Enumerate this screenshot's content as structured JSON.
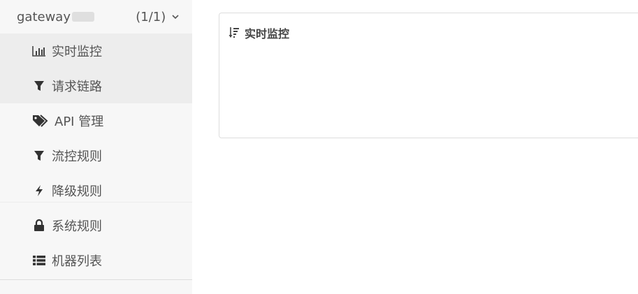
{
  "sidebar": {
    "app_name": "gateway",
    "app_count": "(1/1)",
    "menu": [
      {
        "label": "实时监控",
        "icon": "bar-chart-icon"
      },
      {
        "label": "请求链路",
        "icon": "filter-icon"
      },
      {
        "label": "API 管理",
        "icon": "tags-icon"
      },
      {
        "label": "流控规则",
        "icon": "filter-icon"
      },
      {
        "label": "降级规则",
        "icon": "bolt-icon"
      },
      {
        "label": "系统规则",
        "icon": "lock-icon"
      },
      {
        "label": "机器列表",
        "icon": "list-icon"
      }
    ]
  },
  "main": {
    "panel": {
      "title": "实时监控",
      "icon": "sort-amount-desc-icon"
    }
  }
}
